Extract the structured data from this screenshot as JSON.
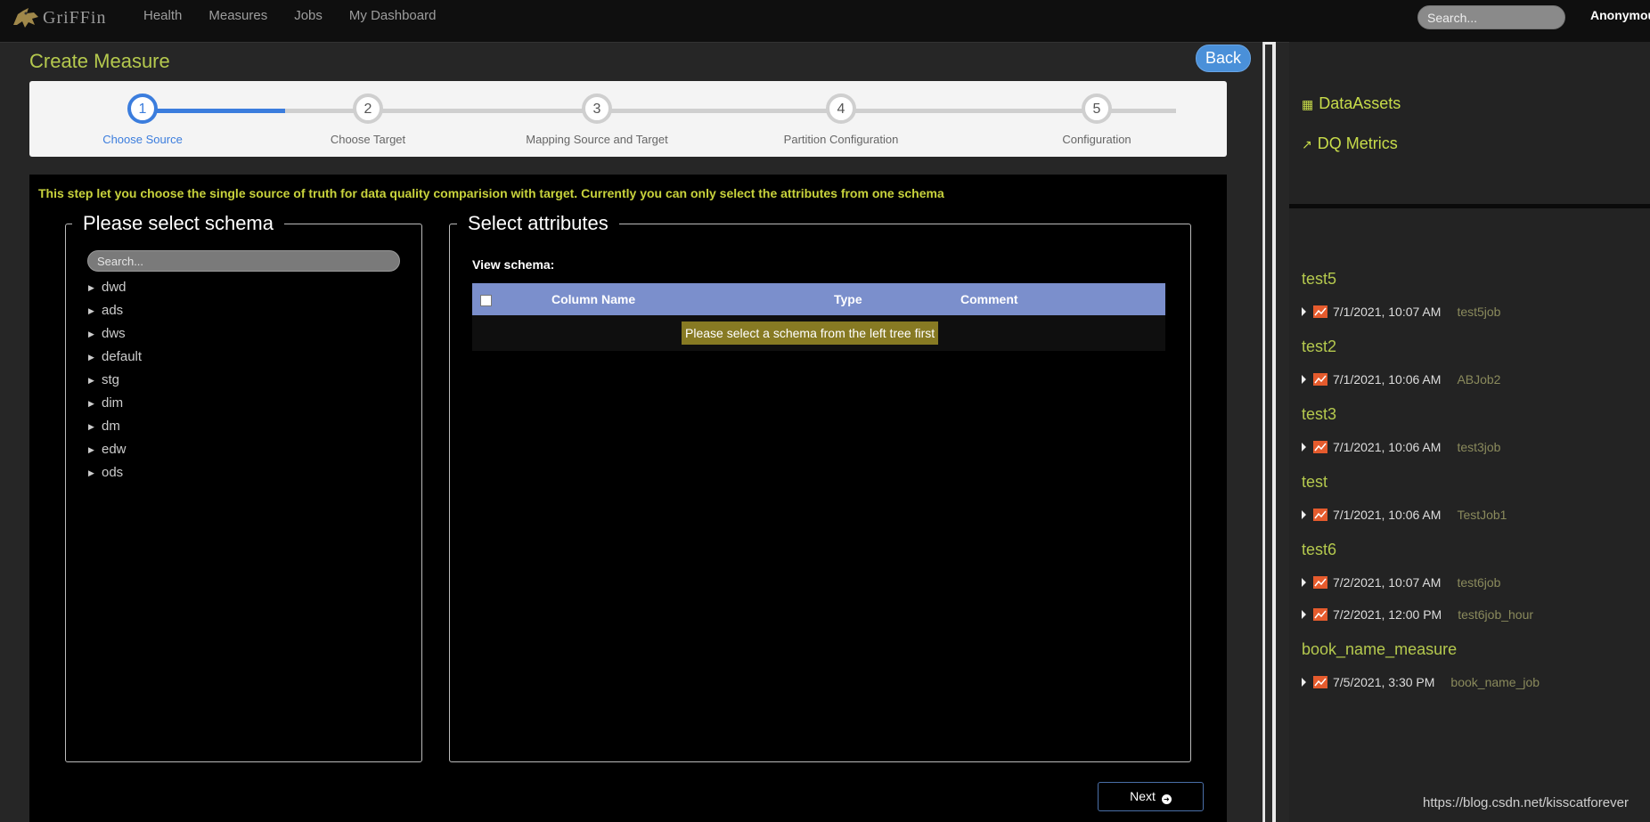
{
  "nav": {
    "brand": "GriFFin",
    "links": [
      "Health",
      "Measures",
      "Jobs",
      "My Dashboard"
    ],
    "search_placeholder": "Search...",
    "user": "Anonymous"
  },
  "page": {
    "title": "Create Measure",
    "back_label": "Back"
  },
  "steps": [
    {
      "num": "1",
      "label": "Choose Source"
    },
    {
      "num": "2",
      "label": "Choose Target"
    },
    {
      "num": "3",
      "label": "Mapping Source and Target"
    },
    {
      "num": "4",
      "label": "Partition Configuration"
    },
    {
      "num": "5",
      "label": "Configuration"
    }
  ],
  "hint": "This step let you choose the single source of truth for data quality comparision with target. Currently you can only select the attributes from one schema",
  "schema_panel": {
    "legend": "Please select schema",
    "search_placeholder": "Search...",
    "items": [
      "dwd",
      "ads",
      "dws",
      "default",
      "stg",
      "dim",
      "dm",
      "edw",
      "ods"
    ]
  },
  "attr_panel": {
    "legend": "Select attributes",
    "view_label": "View schema:",
    "columns": [
      "Column Name",
      "Type",
      "Comment"
    ],
    "empty_message": "Please select a schema from the left tree first"
  },
  "next_label": "Next",
  "sidebar": {
    "links": [
      "DataAssets",
      "DQ Metrics"
    ],
    "measures": [
      {
        "name": "test5",
        "jobs": [
          {
            "time": "7/1/2021, 10:07 AM",
            "job": "test5job"
          }
        ]
      },
      {
        "name": "test2",
        "jobs": [
          {
            "time": "7/1/2021, 10:06 AM",
            "job": "ABJob2"
          }
        ]
      },
      {
        "name": "test3",
        "jobs": [
          {
            "time": "7/1/2021, 10:06 AM",
            "job": "test3job"
          }
        ]
      },
      {
        "name": "test",
        "jobs": [
          {
            "time": "7/1/2021, 10:06 AM",
            "job": "TestJob1"
          }
        ]
      },
      {
        "name": "test6",
        "jobs": [
          {
            "time": "7/2/2021, 10:07 AM",
            "job": "test6job"
          },
          {
            "time": "7/2/2021, 12:00 PM",
            "job": "test6job_hour"
          }
        ]
      },
      {
        "name": "book_name_measure",
        "jobs": [
          {
            "time": "7/5/2021, 3:30 PM",
            "job": "book_name_job"
          }
        ]
      }
    ]
  },
  "watermark": "https://blog.csdn.net/kisscatforever"
}
